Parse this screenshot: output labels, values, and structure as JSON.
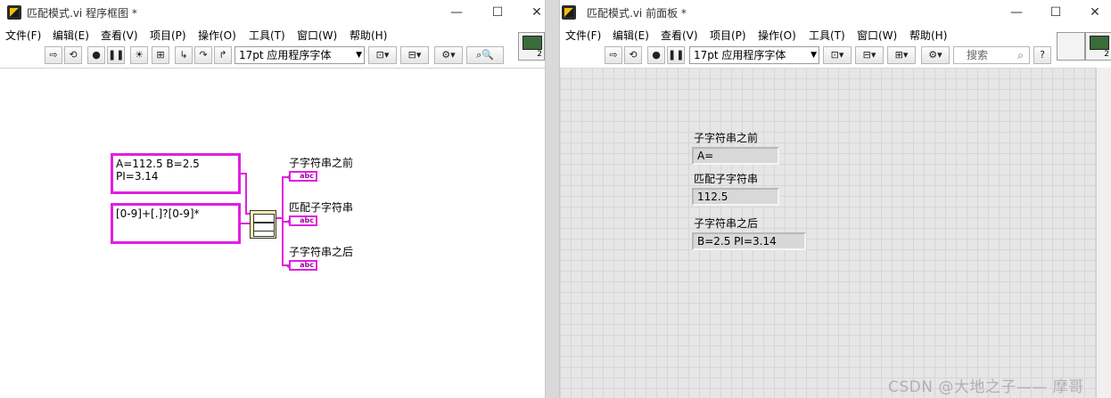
{
  "left_window": {
    "title": "匹配模式.vi 程序框图 *",
    "menu": [
      "文件(F)",
      "编辑(E)",
      "查看(V)",
      "项目(P)",
      "操作(O)",
      "工具(T)",
      "窗口(W)",
      "帮助(H)"
    ],
    "font_label": "17pt 应用程序字体",
    "context_num": "2",
    "constants": {
      "string": "A=112.5 B=2.5 PI=3.14",
      "regex": "[0-9]+[.]?[0-9]*"
    },
    "indicators": [
      "子字符串之前",
      "匹配子字符串",
      "子字符串之后"
    ],
    "indicator_tag": "abc"
  },
  "right_window": {
    "title": "匹配模式.vi 前面板 *",
    "menu": [
      "文件(F)",
      "编辑(E)",
      "查看(V)",
      "项目(P)",
      "操作(O)",
      "工具(T)",
      "窗口(W)",
      "帮助(H)"
    ],
    "font_label": "17pt 应用程序字体",
    "search_placeholder": "搜索",
    "context_num": "2",
    "indicators": [
      {
        "label": "子字符串之前",
        "value": "A="
      },
      {
        "label": "匹配子字符串",
        "value": "112.5"
      },
      {
        "label": "子字符串之后",
        "value": "B=2.5 PI=3.14"
      }
    ]
  },
  "watermark": "CSDN @大地之子—— 摩哥",
  "window_controls": {
    "minimize": "—",
    "maximize": "☐",
    "close": "✕"
  }
}
